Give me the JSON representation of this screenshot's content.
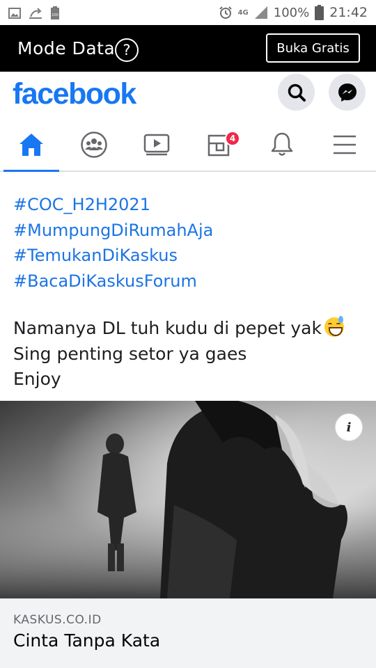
{
  "status_bar": {
    "network": "4G",
    "battery_percent": "100%",
    "time": "21:42"
  },
  "data_banner": {
    "title": "Mode Data",
    "help_symbol": "?",
    "button_label": "Buka Gratis"
  },
  "header": {
    "logo": "facebook",
    "brand_color": "#1877f2"
  },
  "nav": {
    "tabs": [
      {
        "icon": "home-icon",
        "active": true
      },
      {
        "icon": "groups-icon",
        "active": false
      },
      {
        "icon": "watch-icon",
        "active": false
      },
      {
        "icon": "pages-icon",
        "active": false,
        "badge": "4"
      },
      {
        "icon": "bell-icon",
        "active": false
      },
      {
        "icon": "menu-icon",
        "active": false
      }
    ]
  },
  "post": {
    "hashtags": [
      "#COC_H2H2021",
      "#MumpungDiRumahAja",
      "#TemukanDiKaskus",
      "#BacaDiKaskusForum"
    ],
    "lines": [
      "Namanya DL tuh kudu di pepet yak",
      "Sing penting setor ya gaes",
      "Enjoy"
    ],
    "emoji": "grinning-sweat-emoji"
  },
  "link": {
    "domain": "KASKUS.CO.ID",
    "title": "Cinta Tanpa Kata",
    "info_symbol": "i"
  }
}
